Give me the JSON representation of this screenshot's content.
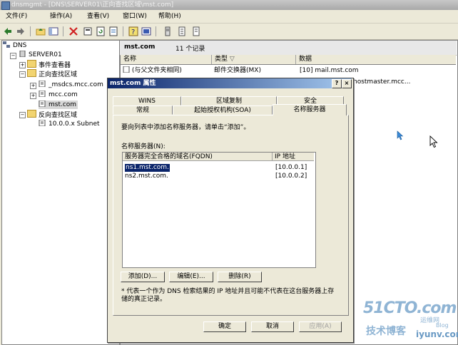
{
  "window": {
    "title": "dnsmgmt - [DNS\\SERVER01\\正向查找区域\\mst.com]"
  },
  "menu": [
    "文件(F)",
    "操作(A)",
    "查看(V)",
    "窗口(W)",
    "帮助(H)"
  ],
  "tree": {
    "root": "DNS",
    "server": "SERVER01",
    "event_viewer": "事件查看器",
    "forward_zones": "正向查找区域",
    "zone_msdcs": "_msdcs.mcc.com",
    "zone_mcc": "mcc.com",
    "zone_mst": "mst.com",
    "reverse_zones": "反向查找区域",
    "reverse_subnet": "10.0.0.x Subnet"
  },
  "list": {
    "zone_name": "mst.com",
    "record_count": "11 个记录",
    "col_name": "名称",
    "col_type": "类型",
    "col_data": "数据",
    "row1_name": "(与父文件夹相同)",
    "row1_type": "邮件交换器(MX)",
    "row1_data": "[10]  mail.mst.com",
    "row2_data_fragment": "hostmaster.mcc..."
  },
  "dialog": {
    "title": "mst.com 属性",
    "help_btn": "?",
    "close_btn": "×",
    "tabs_back": [
      "WINS",
      "区域复制",
      "安全"
    ],
    "tabs_front": [
      "常规",
      "起始授权机构(SOA)",
      "名称服务器"
    ],
    "instruction": "要向列表中添加名称服务器，请单击“添加”。",
    "ns_label": "名称服务器(N):",
    "ns_col_fqdn": "服务器完全合格的域名(FQDN)",
    "ns_col_ip": "IP 地址",
    "ns_rows": [
      {
        "fqdn": "ns1.mst.com.",
        "ip": "[10.0.0.1]"
      },
      {
        "fqdn": "ns2.mst.com.",
        "ip": "[10.0.0.2]"
      }
    ],
    "add_btn": "添加(D)...",
    "edit_btn": "编辑(E)...",
    "remove_btn": "删除(R)",
    "note": "* 代表一个作为 DNS 检索结果的 IP 地址并且可能不代表在这台服务器上存储的真正记录。",
    "ok": "确定",
    "cancel": "取消",
    "apply": "应用(A)"
  },
  "watermark": {
    "line1": "51CTO.com",
    "line2": "技术博客",
    "line3": "运维网",
    "line4": "iyunv.com",
    "line5": "Blog"
  },
  "colors": {
    "dialog_title": "#0a246a",
    "selection": "#0a246a"
  }
}
